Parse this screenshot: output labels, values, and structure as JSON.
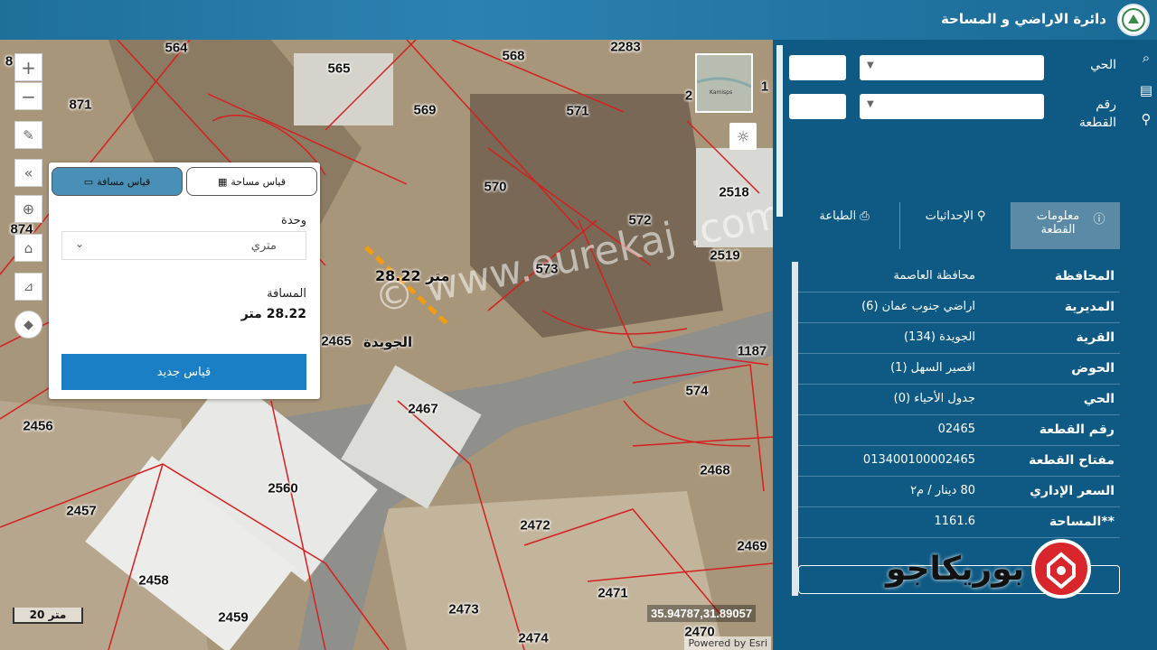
{
  "header": {
    "title": "دائرة الاراضي و المساحة"
  },
  "map": {
    "parcel_labels": [
      {
        "text": "564"
      },
      {
        "text": "565"
      },
      {
        "text": "568"
      },
      {
        "text": "2283"
      },
      {
        "text": "871"
      },
      {
        "text": "569"
      },
      {
        "text": "571"
      },
      {
        "text": "570"
      },
      {
        "text": "572"
      },
      {
        "text": "2518"
      },
      {
        "text": "2519"
      },
      {
        "text": "573"
      },
      {
        "text": "874"
      },
      {
        "text": "2465"
      },
      {
        "text": "1187"
      },
      {
        "text": "574"
      },
      {
        "text": "2467"
      },
      {
        "text": "2456"
      },
      {
        "text": "2468"
      },
      {
        "text": "2560"
      },
      {
        "text": "2457"
      },
      {
        "text": "2472"
      },
      {
        "text": "2469"
      },
      {
        "text": "2458"
      },
      {
        "text": "2471"
      },
      {
        "text": "2473"
      },
      {
        "text": "2459"
      },
      {
        "text": "2470"
      },
      {
        "text": "2474"
      },
      {
        "text": "8"
      },
      {
        "text": "2"
      },
      {
        "text": "1"
      }
    ],
    "measure_label": "28.22 متر",
    "place_label": "الجويدة",
    "coords": "35.94787,31.89057",
    "scale": "20 متر",
    "powered": "Powered by Esri",
    "watermark": "© www.eurekaj .com",
    "minimap_text": "Kamisps",
    "zoom_in": "+",
    "zoom_out": "−"
  },
  "measure_panel": {
    "tab_area": "قياس مساحة",
    "tab_distance": "قياس مسافة",
    "unit_label": "وحدة",
    "unit_value": "متري",
    "distance_label": "المسافة",
    "distance_value": "28.22 متر",
    "new_button": "قياس جديد"
  },
  "search": {
    "district_label": "الحي",
    "parcel_label": "رقم القطعة"
  },
  "info_tabs": [
    {
      "label": "معلومات القطعة",
      "icon": "info-icon",
      "active": true
    },
    {
      "label": "الإحداثيات",
      "icon": "pin-icon",
      "active": false
    },
    {
      "label": "الطباعة",
      "icon": "print-icon",
      "active": false
    }
  ],
  "info": [
    {
      "k": "المحافظة",
      "v": "محافظة العاصمة"
    },
    {
      "k": "المديرية",
      "v": "اراضي جنوب عمان (6)"
    },
    {
      "k": "القرية",
      "v": "الجويدة (134)"
    },
    {
      "k": "الحوض",
      "v": "اقصير السهل (1)"
    },
    {
      "k": "الحي",
      "v": "جدول الأحياء (0)"
    },
    {
      "k": "رقم القطعة",
      "v": "02465"
    },
    {
      "k": "مفتاح القطعة",
      "v": "013400100002465"
    },
    {
      "k": "السعر الإداري",
      "v": "80 دينار / م٢"
    },
    {
      "k": "**المساحة",
      "v": "1161.6"
    }
  ],
  "brand": {
    "text": "بوريكاجو"
  },
  "colors": {
    "header": "#2b82b0",
    "sidebar": "#0e5a84",
    "parcel_line": "#d42020",
    "button": "#1a7fc4",
    "brand_red": "#d8262c"
  }
}
